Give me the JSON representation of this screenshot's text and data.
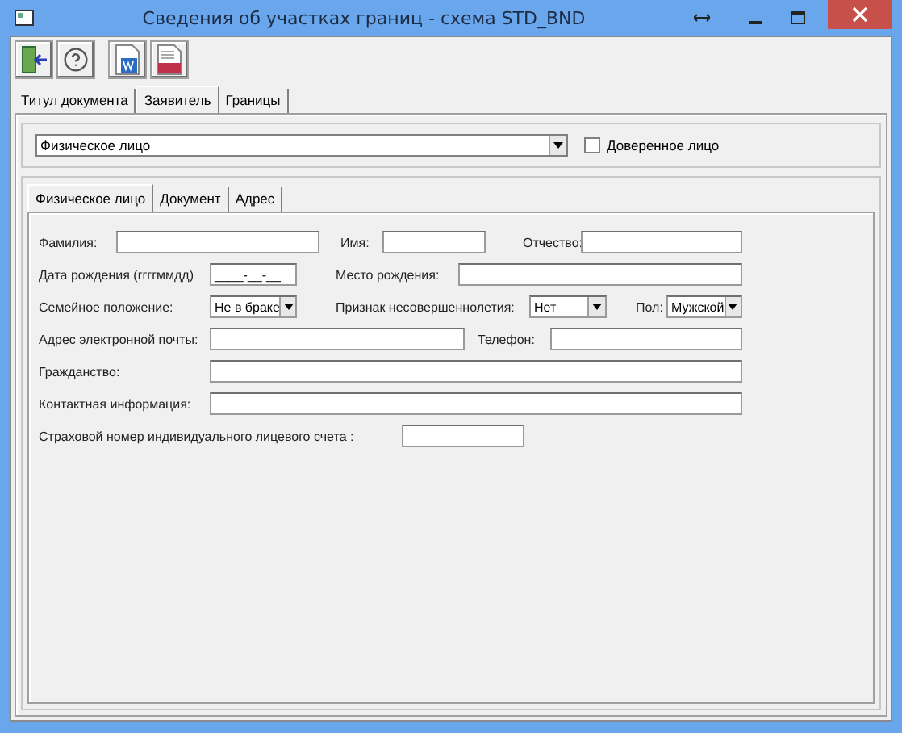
{
  "window": {
    "title": "Сведения об участках границ - схема STD_BND"
  },
  "toolbar": [
    {
      "kind": "exit"
    },
    {
      "kind": "help"
    },
    {
      "kind": "word"
    },
    {
      "kind": "xml"
    }
  ],
  "tabs": [
    {
      "label": "Титул документа",
      "selected": false
    },
    {
      "label": "Заявитель",
      "selected": true
    },
    {
      "label": "Границы",
      "selected": false
    }
  ],
  "applicant_type": {
    "value": "Физическое лицо"
  },
  "trusted_person": {
    "label": "Доверенное лицо",
    "checked": false
  },
  "subtabs": [
    {
      "label": "Физическое лицо",
      "selected": true
    },
    {
      "label": "Документ",
      "selected": false
    },
    {
      "label": "Адрес",
      "selected": false
    }
  ],
  "form_rows": [
    [
      {
        "kind": "label",
        "text": "Фамилия:"
      },
      {
        "kind": "input"
      },
      {
        "kind": "label",
        "text": "Имя:"
      },
      {
        "kind": "input"
      },
      {
        "kind": "label",
        "text": "Отчество:"
      },
      {
        "kind": "input"
      }
    ],
    [
      {
        "kind": "label",
        "text": "Дата рождения (ггггммдд)"
      },
      {
        "kind": "input",
        "value": "____-__-__"
      },
      {
        "kind": "label",
        "text": "Место рождения:"
      },
      {
        "kind": "input"
      }
    ],
    [
      {
        "kind": "label",
        "text": "Семейное положение:"
      },
      {
        "kind": "select",
        "value": "Не в браке"
      },
      {
        "kind": "label",
        "text": "Признак несовершеннолетия:"
      },
      {
        "kind": "select",
        "value": "Нет"
      },
      {
        "kind": "label",
        "text": "Пол:"
      },
      {
        "kind": "select",
        "value": "Мужской"
      }
    ],
    [
      {
        "kind": "label",
        "text": "Адрес электронной почты:"
      },
      {
        "kind": "input"
      },
      {
        "kind": "label",
        "text": "Телефон:"
      },
      {
        "kind": "input"
      }
    ],
    [
      {
        "kind": "label",
        "text": "Гражданство:"
      },
      {
        "kind": "input"
      }
    ],
    [
      {
        "kind": "label",
        "text": "Контактная информация:"
      },
      {
        "kind": "input"
      }
    ],
    [
      {
        "kind": "label",
        "text": "Страховой номер индивидуального лицевого счета :"
      },
      {
        "kind": "input"
      }
    ]
  ]
}
